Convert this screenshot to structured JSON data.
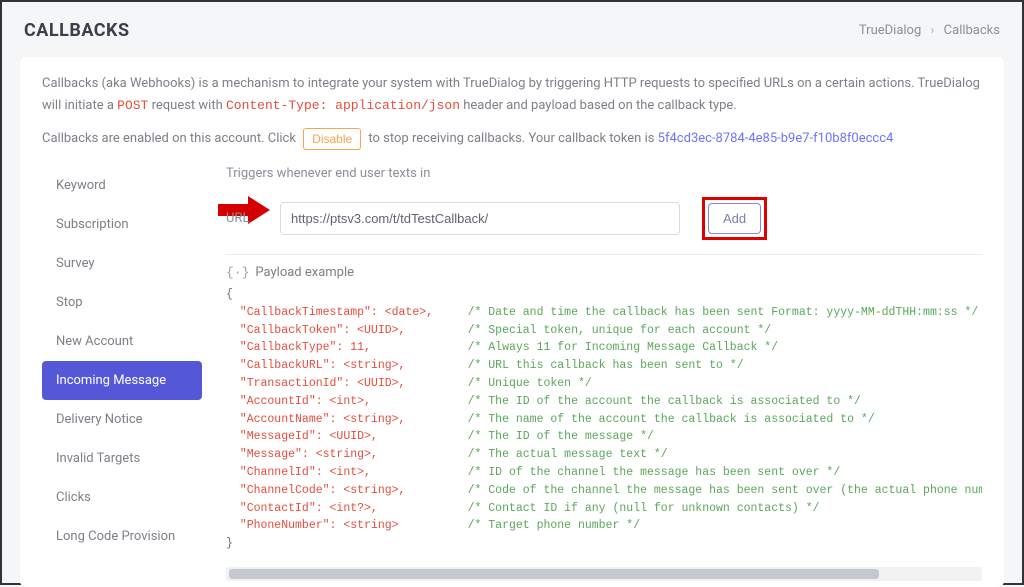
{
  "header": {
    "title": "CALLBACKS",
    "breadcrumb_root": "TrueDialog",
    "breadcrumb_current": "Callbacks"
  },
  "intro": {
    "line1_a": "Callbacks (aka Webhooks) is a mechanism to integrate your system with TrueDialog by triggering HTTP requests to specified URLs on a certain actions. TrueDialog will initiate a ",
    "post": "POST",
    "line1_b": " request with ",
    "content_type": "Content-Type: application/json",
    "line1_c": " header and payload based on the callback type."
  },
  "enable": {
    "pre": "Callbacks are enabled on this account. Click ",
    "button": "Disable",
    "mid": " to stop receiving callbacks. Your callback token is ",
    "token": "5f4cd3ec-8784-4e85-b9e7-f10b8f0eccc4"
  },
  "sidebar": {
    "items": [
      {
        "label": "Keyword"
      },
      {
        "label": "Subscription"
      },
      {
        "label": "Survey"
      },
      {
        "label": "Stop"
      },
      {
        "label": "New Account"
      },
      {
        "label": "Incoming Message",
        "active": true
      },
      {
        "label": "Delivery Notice"
      },
      {
        "label": "Invalid Targets"
      },
      {
        "label": "Clicks"
      },
      {
        "label": "Long Code Provision"
      }
    ]
  },
  "content": {
    "trigger_desc": "Triggers whenever end user texts in",
    "url_label": "URL",
    "url_value": "https://ptsv3.com/t/tdTestCallback/",
    "add_label": "Add",
    "payload_title": "Payload example"
  },
  "payload": {
    "open": "{",
    "close": "}",
    "lines": [
      {
        "key": "\"CallbackTimestamp\": <date>,",
        "comment": "/* Date and time the callback has been sent Format: yyyy-MM-ddTHH:mm:ss */"
      },
      {
        "key": "\"CallbackToken\": <UUID>,",
        "comment": "/* Special token, unique for each account */"
      },
      {
        "key": "\"CallbackType\": 11,",
        "comment": "/* Always 11 for Incoming Message Callback */"
      },
      {
        "key": "\"CallbackURL\": <string>,",
        "comment": "/* URL this callback has been sent to */"
      },
      {
        "key": "\"TransactionId\": <UUID>,",
        "comment": "/* Unique token */"
      },
      {
        "key": "\"AccountId\": <int>,",
        "comment": "/* The ID of the account the callback is associated to */"
      },
      {
        "key": "\"AccountName\": <string>,",
        "comment": "/* The name of the account the callback is associated to */"
      },
      {
        "key": "\"MessageId\": <UUID>,",
        "comment": "/* The ID of the message */"
      },
      {
        "key": "\"Message\": <string>,",
        "comment": "/* The actual message text */"
      },
      {
        "key": "\"ChannelId\": <int>,",
        "comment": "/* ID of the channel the message has been sent over */"
      },
      {
        "key": "\"ChannelCode\": <string>,",
        "comment": "/* Code of the channel the message has been sent over (the actual phone number for long co"
      },
      {
        "key": "\"ContactId\": <int?>,",
        "comment": "/* Contact ID if any (null for unknown contacts) */"
      },
      {
        "key": "\"PhoneNumber\": <string>",
        "comment": "/* Target phone number */"
      }
    ]
  }
}
